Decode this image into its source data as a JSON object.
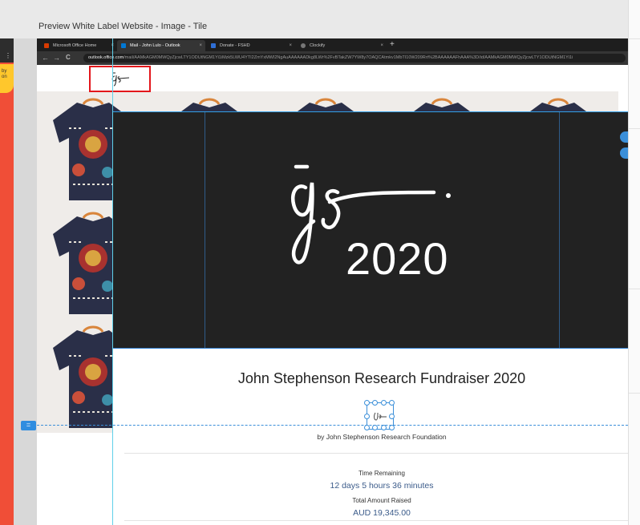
{
  "preview": {
    "title": "Preview White Label Website - Image - Tile"
  },
  "left_panel": {
    "tag_line1": "by",
    "tag_line2": "on",
    "dots": "⋮"
  },
  "browser": {
    "tabs": [
      {
        "label": "Microsoft Office Home",
        "favicon_color": "#d83b01"
      },
      {
        "label": "Mail - John Lulo - Outlook",
        "favicon_color": "#0078d4"
      },
      {
        "label": "Donate - FSHD",
        "favicon_color": "#2f6fd6"
      },
      {
        "label": "Clockify",
        "favicon_color": "#03a9f4"
      }
    ],
    "close_glyph": "×",
    "new_tab_glyph": "+",
    "nav": {
      "back": "←",
      "forward": "→",
      "reload": "C"
    },
    "url_host": "outlook.office.com",
    "url_path": "/mail/AAMkAGM0MWQyZjcwLTY1ODUtNGM1Yi1iMzk5LWU4YTI2ZmYxMWI2NgAuAAAAAADkg8LWr%2FvBTakZW7YW8y7OAQCAtmkv1MbTI10W209Rrt%2BAAAAAAFhAAA%3D/id/AAMkAGM0MWQyZjcwLTY1ODUtNGM1Yi1i"
  },
  "hero": {
    "year": "2020"
  },
  "fundraiser": {
    "title": "John Stephenson Research Fundraiser 2020",
    "by_line": "by John Stephenson Research Foundation",
    "time_label": "Time Remaining",
    "time_value": "12 days 5 hours 36 minutes",
    "raised_label": "Total Amount Raised",
    "raised_value": "AUD 19,345.00"
  },
  "editor": {
    "marker_glyph": "="
  },
  "colors": {
    "accent_blue": "#2f8de0",
    "highlight_red": "#e3161b",
    "hero_bg": "#222222",
    "left_panel_red": "#f04e37"
  },
  "icons": [
    "microsoft-office-favicon",
    "outlook-favicon",
    "fshd-favicon",
    "clockify-favicon",
    "js-signature-logo",
    "shirt-image"
  ]
}
